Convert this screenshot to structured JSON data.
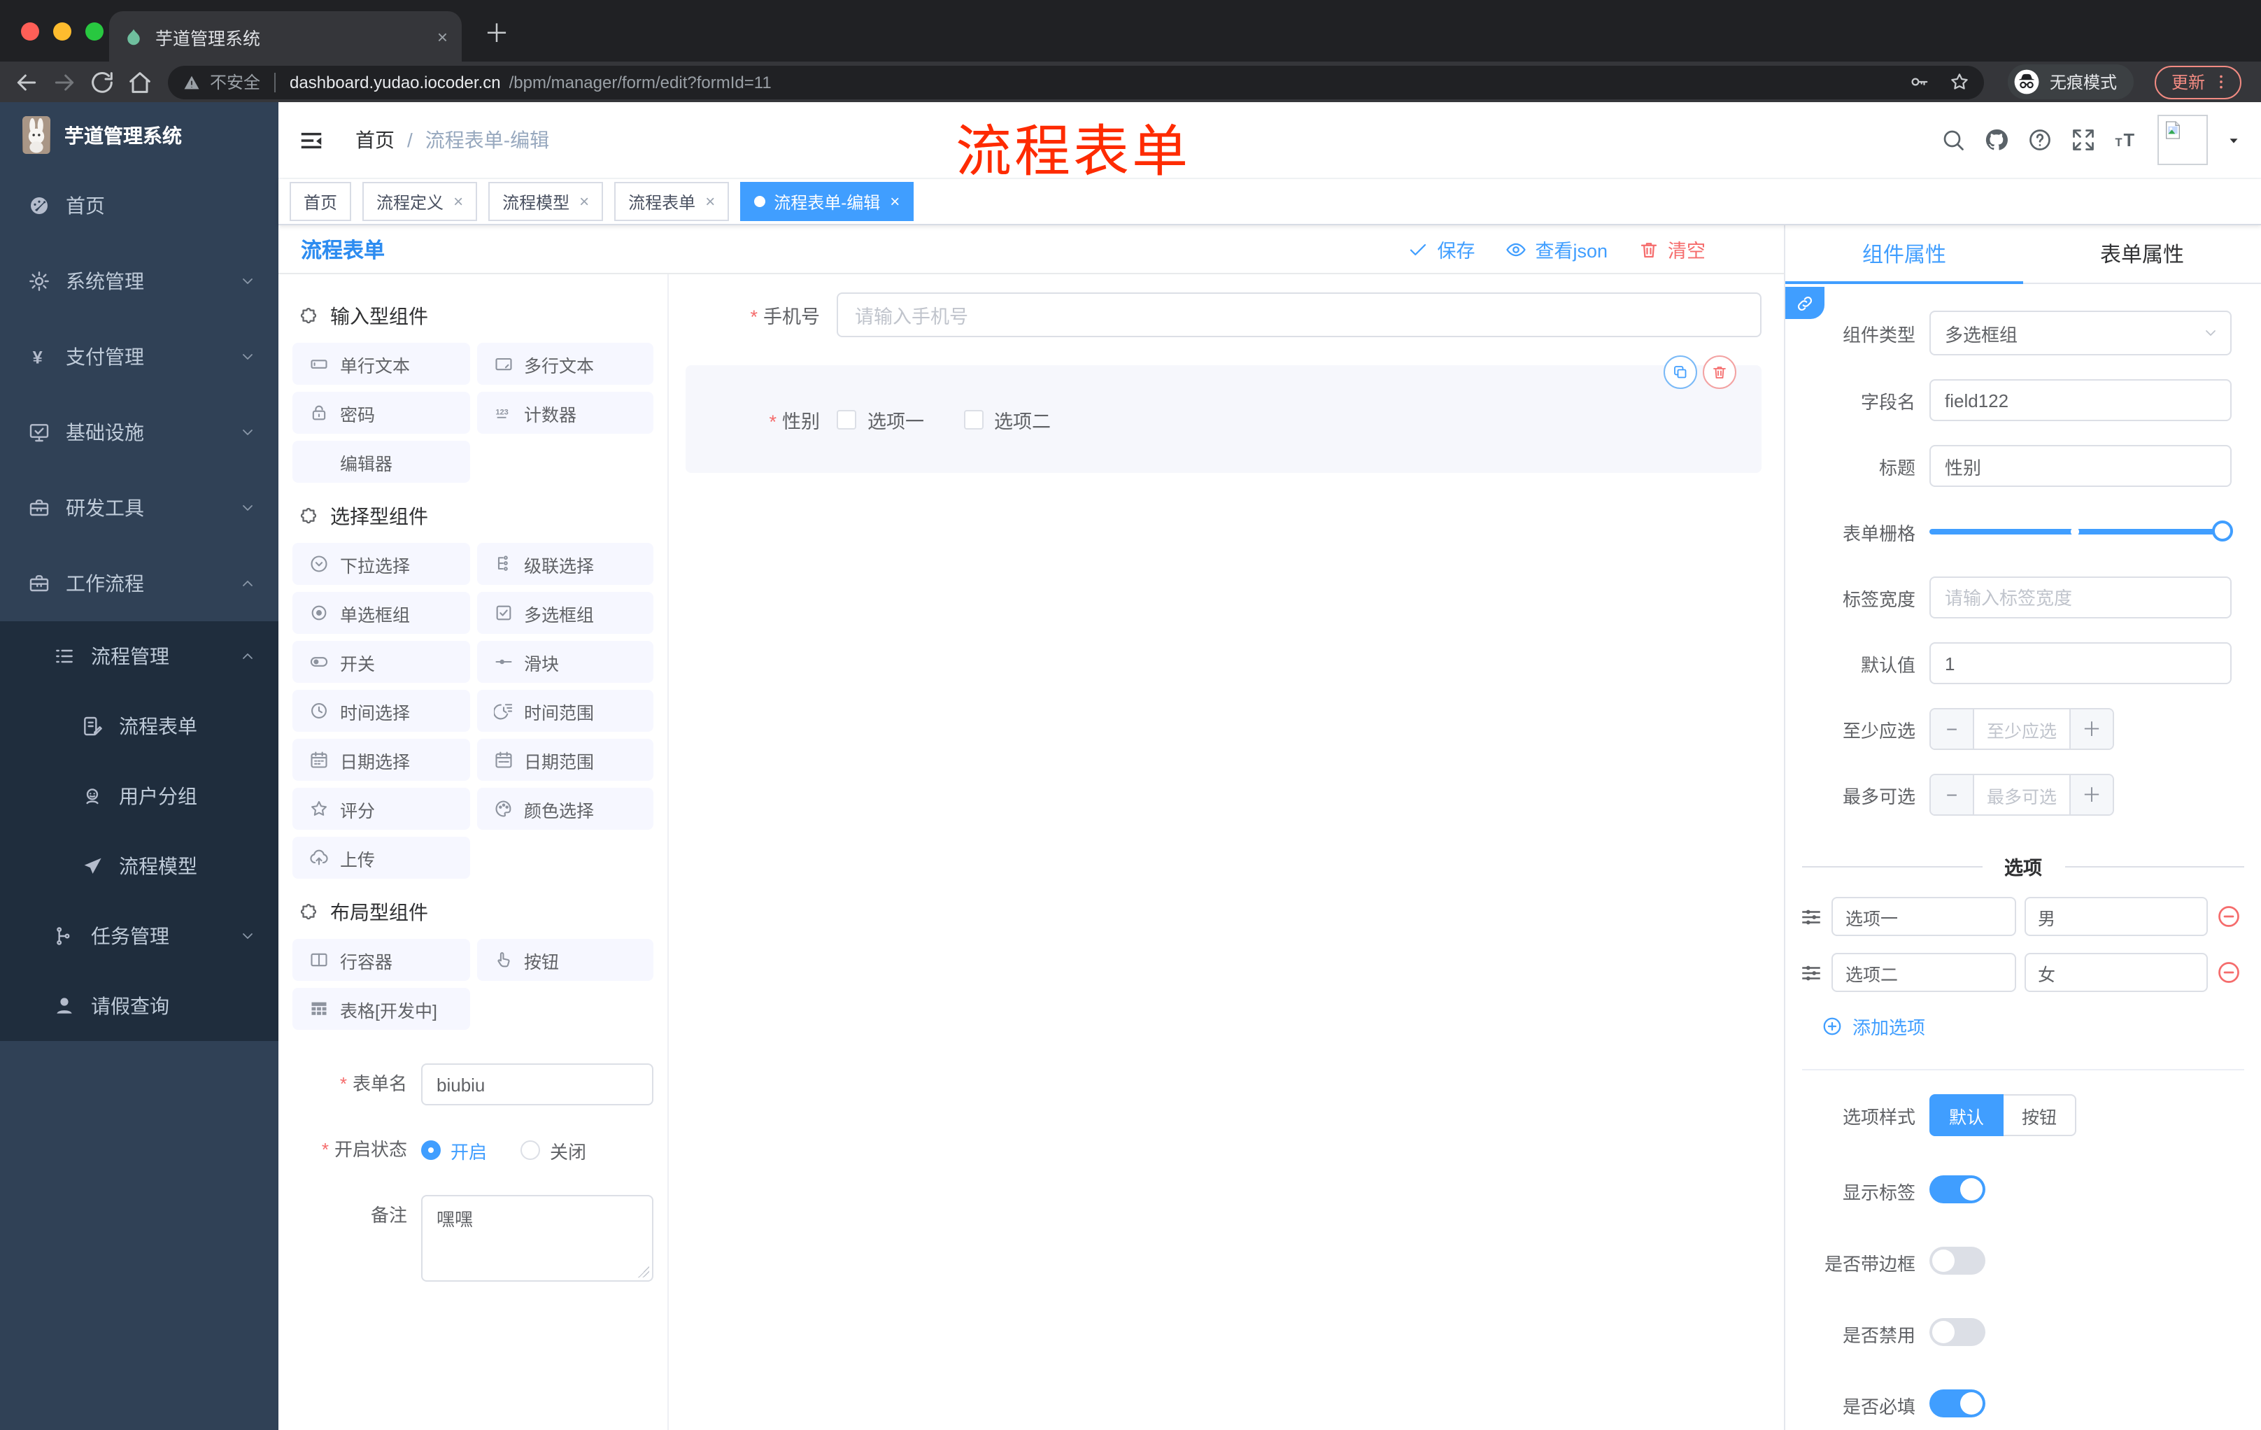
{
  "browser": {
    "tab_title": "芋道管理系统",
    "security_label": "不安全",
    "url_host": "dashboard.yudao.iocoder.cn",
    "url_path": "/bpm/manager/form/edit?formId=11",
    "incognito_label": "无痕模式",
    "update_label": "更新"
  },
  "annotation": {
    "text": "流程表单",
    "color": "#fe2b01"
  },
  "sidebar": {
    "logo_title": "芋道管理系统",
    "items": [
      {
        "label": "首页",
        "icon": "dashboard-icon",
        "arrow": ""
      },
      {
        "label": "系统管理",
        "icon": "gear-icon",
        "arrow": "chevron-down-icon"
      },
      {
        "label": "支付管理",
        "icon": "yen-icon",
        "arrow": "chevron-down-icon"
      },
      {
        "label": "基础设施",
        "icon": "monitor-icon",
        "arrow": "chevron-down-icon"
      },
      {
        "label": "研发工具",
        "icon": "toolbox-icon",
        "arrow": "chevron-down-icon"
      },
      {
        "label": "工作流程",
        "icon": "toolbox-icon",
        "arrow": "chevron-up-icon"
      }
    ],
    "submenu": [
      {
        "label": "流程管理",
        "icon": "list-tree-icon",
        "arrow": "chevron-up-icon",
        "nested": false
      },
      {
        "label": "流程表单",
        "icon": "doc-edit-icon",
        "arrow": "",
        "nested": true
      },
      {
        "label": "用户分组",
        "icon": "user-group-icon",
        "arrow": "",
        "nested": true
      },
      {
        "label": "流程模型",
        "icon": "paper-plane-icon",
        "arrow": "",
        "nested": true
      },
      {
        "label": "任务管理",
        "icon": "tree-icon",
        "arrow": "chevron-down-icon",
        "nested": false
      },
      {
        "label": "请假查询",
        "icon": "person-icon",
        "arrow": "",
        "nested": false
      }
    ]
  },
  "header": {
    "breadcrumb_home": "首页",
    "breadcrumb_separator": "/",
    "breadcrumb_current": "流程表单-编辑"
  },
  "tags": [
    {
      "label": "首页",
      "closable": false,
      "active": false
    },
    {
      "label": "流程定义",
      "closable": true,
      "active": false
    },
    {
      "label": "流程模型",
      "closable": true,
      "active": false
    },
    {
      "label": "流程表单",
      "closable": true,
      "active": false
    },
    {
      "label": "流程表单-编辑",
      "closable": true,
      "active": true
    }
  ],
  "builder": {
    "title": "流程表单",
    "toolbar": {
      "save": "保存",
      "view_json": "查看json",
      "clear": "清空"
    },
    "palette": {
      "sections": [
        {
          "title": "输入型组件",
          "items": [
            {
              "label": "单行文本",
              "icon": "input-icon"
            },
            {
              "label": "多行文本",
              "icon": "textarea-icon"
            },
            {
              "label": "密码",
              "icon": "lock-icon"
            },
            {
              "label": "计数器",
              "icon": "number-icon"
            },
            {
              "label": "编辑器",
              "icon": "none"
            }
          ]
        },
        {
          "title": "选择型组件",
          "items": [
            {
              "label": "下拉选择",
              "icon": "select-icon"
            },
            {
              "label": "级联选择",
              "icon": "cascader-icon"
            },
            {
              "label": "单选框组",
              "icon": "radio-icon"
            },
            {
              "label": "多选框组",
              "icon": "checkbox-icon"
            },
            {
              "label": "开关",
              "icon": "switch-icon"
            },
            {
              "label": "滑块",
              "icon": "slider-icon"
            },
            {
              "label": "时间选择",
              "icon": "time-icon"
            },
            {
              "label": "时间范围",
              "icon": "time-range-icon"
            },
            {
              "label": "日期选择",
              "icon": "date-icon"
            },
            {
              "label": "日期范围",
              "icon": "date-range-icon"
            },
            {
              "label": "评分",
              "icon": "star-icon"
            },
            {
              "label": "颜色选择",
              "icon": "color-icon"
            },
            {
              "label": "上传",
              "icon": "upload-icon"
            }
          ]
        },
        {
          "title": "布局型组件",
          "items": [
            {
              "label": "行容器",
              "icon": "row-icon"
            },
            {
              "label": "按钮",
              "icon": "hand-icon"
            },
            {
              "label": "表格[开发中]",
              "icon": "table-icon"
            }
          ]
        }
      ]
    },
    "meta": {
      "name_label": "表单名",
      "name_value": "biubiu",
      "status_label": "开启状态",
      "status_on": "开启",
      "status_off": "关闭",
      "remark_label": "备注",
      "remark_value": "嘿嘿"
    },
    "canvas": {
      "phone": {
        "label": "手机号",
        "placeholder": "请输入手机号"
      },
      "gender": {
        "label": "性别",
        "options": [
          "选项一",
          "选项二"
        ]
      }
    },
    "props": {
      "tab_component": "组件属性",
      "tab_form": "表单属性",
      "type_label": "组件类型",
      "type_value": "多选框组",
      "field_label": "字段名",
      "field_value": "field122",
      "title_label": "标题",
      "title_value": "性别",
      "grid_label": "表单栅格",
      "label_width_label": "标签宽度",
      "label_width_placeholder": "请输入标签宽度",
      "default_label": "默认值",
      "default_value": "1",
      "min_label": "至少应选",
      "min_placeholder": "至少应选",
      "max_label": "最多可选",
      "max_placeholder": "最多可选",
      "options_title": "选项",
      "options": [
        {
          "label": "选项一",
          "value": "男"
        },
        {
          "label": "选项二",
          "value": "女"
        }
      ],
      "add_option": "添加选项",
      "style_label": "选项样式",
      "style_default": "默认",
      "style_button": "按钮",
      "switches": [
        {
          "label": "显示标签",
          "on": true
        },
        {
          "label": "是否带边框",
          "on": false
        },
        {
          "label": "是否禁用",
          "on": false
        },
        {
          "label": "是否必填",
          "on": true
        }
      ]
    }
  },
  "colors": {
    "primary": "#409eff",
    "danger": "#f56c6c",
    "sidebar_bg": "#304156",
    "submenu_bg": "#1f2d3d",
    "annotation_red": "#fe2b01"
  }
}
